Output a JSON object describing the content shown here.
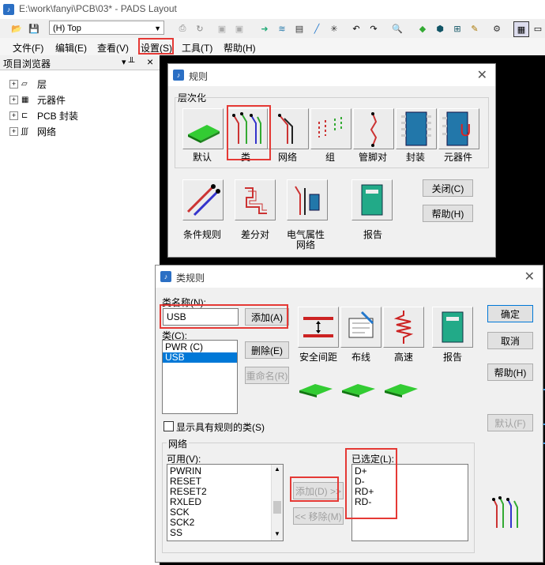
{
  "window": {
    "title": "E:\\work\\fanyi\\PCB\\03* - PADS Layout"
  },
  "toolbar": {
    "layer_value": "(H) Top"
  },
  "menu": {
    "items": [
      "文件(F)",
      "编辑(E)",
      "查看(V)",
      "设置(S)",
      "工具(T)",
      "帮助(H)"
    ]
  },
  "browser": {
    "title": "项目浏览器",
    "pin": "▾ ╨",
    "close": "×",
    "items": [
      "层",
      "元器件",
      "PCB 封装",
      "网络"
    ]
  },
  "rules_dialog": {
    "title": "规则",
    "hierarchy_label": "层次化",
    "hier_buttons": [
      "默认",
      "类",
      "网络",
      "组",
      "管脚对",
      "封装",
      "元器件"
    ],
    "other_buttons": [
      "条件规则",
      "差分对",
      "电气属性网络",
      "报告"
    ],
    "close_btn": "关闭(C)",
    "help_btn": "帮助(H)"
  },
  "class_dialog": {
    "title": "类规则",
    "name_label": "类名称(N):",
    "name_value": "USB",
    "add_btn": "添加(A)",
    "class_label": "类(C):",
    "class_list": [
      "PWR  (C)",
      "USB"
    ],
    "selected_class": "USB",
    "delete_btn": "删除(E)",
    "rename_btn": "重命名(R)",
    "rule_buttons": [
      "安全间距",
      "布线",
      "高速",
      "报告"
    ],
    "ok_btn": "确定",
    "cancel_btn": "取消",
    "help_btn": "帮助(H)",
    "default_btn": "默认(F)",
    "show_checkbox_label": "显示具有规则的类(S)",
    "net_group_label": "网络",
    "available_label": "可用(V):",
    "available_nets": [
      "PWRIN",
      "RESET",
      "RESET2",
      "RXLED",
      "SCK",
      "SCK2",
      "SS"
    ],
    "add_net_btn": "添加(D) >>",
    "remove_net_btn": "<< 移除(M)",
    "selected_label": "已选定(L):",
    "selected_nets": [
      "D+",
      "D-",
      "RD+",
      "RD-"
    ]
  }
}
